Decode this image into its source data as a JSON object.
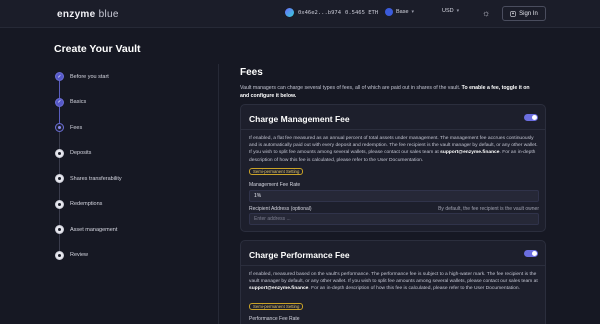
{
  "header": {
    "logo_main": "enzyme",
    "logo_sub": "blue",
    "wallet_address": "0x46e2...b974",
    "wallet_balance": "0.5465 ETH",
    "network": "Base",
    "currency": "USD",
    "signin_label": "Sign In"
  },
  "page_title": "Create Your Vault",
  "steps": [
    {
      "label": "Before you start",
      "state": "done"
    },
    {
      "label": "Basics",
      "state": "done"
    },
    {
      "label": "Fees",
      "state": "current"
    },
    {
      "label": "Deposits",
      "state": "todo"
    },
    {
      "label": "Shares transferability",
      "state": "todo"
    },
    {
      "label": "Redemptions",
      "state": "todo"
    },
    {
      "label": "Asset management",
      "state": "todo"
    },
    {
      "label": "Review",
      "state": "todo"
    }
  ],
  "main": {
    "title": "Fees",
    "intro": "Vault managers can charge several types of fees, all of which are paid out in shares of the vault.",
    "intro_bold": "To enable a fee, toggle it on and configure it below."
  },
  "management_fee": {
    "title": "Charge Management Fee",
    "enabled": true,
    "desc_1": "If enabled, a flat fee measured as an annual percent of total assets under management. The management fee accrues continuously and is automatically paid out with every deposit and redemption. The fee recipient is the vault manager by default, or any other wallet. If you wish to split fee amounts among several wallets, please contact our sales team at",
    "email": "support@enzyme.finance",
    "desc_2": ". For an in-depth description of how this fee is calculated, please refer to the User Documentation.",
    "badge": "Semi-permanent Setting",
    "rate_label": "Management Fee Rate",
    "rate_value": "1%",
    "recipient_label": "Recipient Address (optional)",
    "recipient_hint": "By default, the fee recipient is the vault owner",
    "recipient_placeholder": "Enter address ..."
  },
  "performance_fee": {
    "title": "Charge Performance Fee",
    "enabled": true,
    "desc_1": "If enabled, measured based on the vault's performance. The performance fee is subject to a high-water mark. The fee recipient is the vault manager by default, or any other wallet. If you wish to split fee amounts among several wallets, please contact our sales team at",
    "email": "support@enzyme.finance",
    "desc_2": ". For an in-depth description of how this fee is calculated, please refer to the User Documentation.",
    "badge": "Semi-permanent Setting",
    "rate_label": "Performance Fee Rate"
  }
}
